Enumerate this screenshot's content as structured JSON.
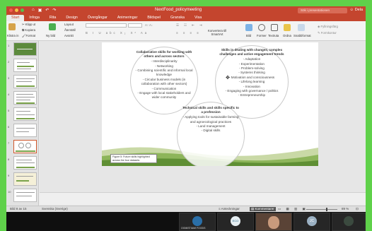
{
  "window": {
    "title": "NextFood_policymeeting",
    "search_placeholder": "Sök i presentationen",
    "share_label": "Dela"
  },
  "menu_tabs": [
    "Start",
    "Infoga",
    "Rita",
    "Design",
    "Övergångar",
    "Animeringar",
    "Bildspel",
    "Granska",
    "Visa"
  ],
  "ribbon": {
    "paste": "Klistra in",
    "cut": "Klipp ut",
    "copy": "Kopiera",
    "format": "Format",
    "new_slide": "Ny bild",
    "layout": "Layout",
    "reset": "Återställ",
    "section": "Avsnitt",
    "convert": "Konvertera till SmartArt",
    "image": "Bild",
    "shapes": "Former",
    "textbox": "Textruta",
    "arrange": "Ordna",
    "quick_styles": "Snabbformat",
    "fill": "Fyllningsfärg",
    "outline": "Formkontur"
  },
  "slide_numbers": [
    "1",
    "2",
    "3",
    "4",
    "5",
    "6",
    "7",
    "8",
    "9",
    "10"
  ],
  "slide": {
    "circle_collab": {
      "heading": "Collaborative skills for working with others and across sectors",
      "items": [
        "- Interdisciplinarity",
        "- Networking",
        "- Combining scientific and informal local knowledge",
        "- Circular business models (in collaboration with other sectors)",
        "- Communication",
        "- Engage with local stakeholders and wider community"
      ]
    },
    "circle_change": {
      "heading": "Skills in dealing with changes, complex challenges and active engagement trends",
      "items": [
        "- Adaptation",
        "- Experimentation",
        "- Problem-solving",
        "- Systems thinking",
        "- Motivation and consciousness",
        "- Lifelong learning",
        "- Innovation",
        "- Engaging with governance / politics",
        "- Entrepreneurship"
      ]
    },
    "circle_technical": {
      "heading": "Technical skills and skills specific to a profession",
      "items": [
        "- Applying tools for sustainable farming and agroecological practices",
        "- Land management",
        "- Digital skills"
      ]
    },
    "caption": "Figure 5: Future skills highlighted across the four datasets"
  },
  "status": {
    "slide_counter": "Bild 8 av 15",
    "language": "Svenska (Sverige)",
    "notes": "Anteckningar",
    "comments": "Kommentarer",
    "zoom": "89 %"
  },
  "participants": [
    {
      "name": "OGMISTIAMI FOODS",
      "initials": ""
    },
    {
      "name": "",
      "initials": "ECO"
    },
    {
      "name": "",
      "initials": ""
    },
    {
      "name": "",
      "initials": "JC"
    },
    {
      "name": "",
      "initials": ""
    }
  ],
  "colors": {
    "accent": "#c4452e",
    "frame_green": "#5fd14a",
    "grass": "#7aa34a"
  }
}
